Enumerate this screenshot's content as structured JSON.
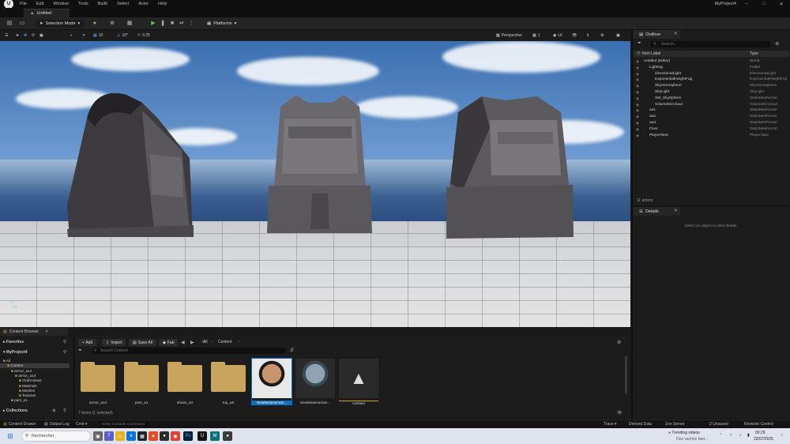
{
  "menubar": {
    "items": [
      "File",
      "Edit",
      "Window",
      "Tools",
      "Build",
      "Select",
      "Actor",
      "Help"
    ],
    "project_name": "MyProject4"
  },
  "tabs": {
    "level": "Untitled"
  },
  "toolbar": {
    "selection_mode": "Selection Mode",
    "platforms": "Platforms"
  },
  "viewport_bar": {
    "perspective": "Perspective",
    "lit": "Lit",
    "snap_translate": "10",
    "snap_rotate": "10°",
    "snap_scale": "0.25",
    "camera_speed": "1"
  },
  "outliner": {
    "tab": "Outliner",
    "search_placeholder": "Search...",
    "col_label": "Item Label",
    "col_type": "Type",
    "rows": [
      {
        "label": "Untitled (Editor)",
        "type": "World",
        "indent": 0
      },
      {
        "label": "Lighting",
        "type": "Folder",
        "indent": 1
      },
      {
        "label": "DirectionalLight",
        "type": "DirectionalLight",
        "indent": 2
      },
      {
        "label": "ExponentialHeightFog",
        "type": "ExponentialHeightFog",
        "indent": 2
      },
      {
        "label": "SkyAtmosphere",
        "type": "SkyAtmosphere",
        "indent": 2
      },
      {
        "label": "SkyLight",
        "type": "SkyLight",
        "indent": 2
      },
      {
        "label": "SM_SkySphere",
        "type": "StaticMeshActor",
        "indent": 2
      },
      {
        "label": "VolumetricCloud",
        "type": "VolumetricCloud",
        "indent": 2
      },
      {
        "label": "aa1",
        "type": "StaticMeshActor",
        "indent": 1
      },
      {
        "label": "aa2",
        "type": "StaticMeshActor",
        "indent": 1
      },
      {
        "label": "aa3",
        "type": "StaticMeshActor",
        "indent": 1
      },
      {
        "label": "Floor",
        "type": "StaticMeshActor",
        "indent": 1
      },
      {
        "label": "PlayerStart",
        "type": "PlayerStart",
        "indent": 1
      }
    ],
    "actor_count": "11 actors"
  },
  "details": {
    "tab": "Details",
    "empty_text": "Select an object to view details."
  },
  "content_browser": {
    "tab": "Content Browser",
    "favorites": "Favorites",
    "project": "MyProject4",
    "collections": "Collections",
    "add": "Add",
    "import": "Import",
    "save_all": "Save All",
    "fab": "Fab",
    "path": [
      "All",
      "Content"
    ],
    "search_placeholder": "Search Content",
    "tree": [
      {
        "label": "All",
        "indent": 0
      },
      {
        "label": "Content",
        "indent": 1,
        "selected": true
      },
      {
        "label": "armor_a14",
        "indent": 2
      },
      {
        "label": "armor_a14",
        "indent": 3
      },
      {
        "label": "ClothAssets",
        "indent": 4
      },
      {
        "label": "Materials",
        "indent": 4
      },
      {
        "label": "Meshes",
        "indent": 4
      },
      {
        "label": "Textures",
        "indent": 4
      },
      {
        "label": "pant_a1",
        "indent": 2
      }
    ],
    "assets": [
      {
        "name": "armor_a14",
        "kind": "folder"
      },
      {
        "name": "pant_a1",
        "kind": "folder"
      },
      {
        "name": "shoes_a3",
        "kind": "folder"
      },
      {
        "name": "top_a6",
        "kind": "folder"
      },
      {
        "name": "NewMetaHuman...",
        "kind": "metahuman-a",
        "selected": true
      },
      {
        "name": "NewMetaHuman...",
        "kind": "metahuman-b"
      },
      {
        "name": "Untitled",
        "kind": "level"
      }
    ],
    "item_count": "7 items (1 selected)"
  },
  "statusbar": {
    "content_drawer": "Content Drawer",
    "output_log": "Output Log",
    "cmd": "Cmd",
    "console_placeholder": "Enter Console Command",
    "trace": "Trace",
    "derived_data": "Derived Data",
    "zen_server": "Zen Server",
    "unsaved": "2 Unsaved",
    "revision_control": "Revision Control"
  },
  "taskbar": {
    "search_placeholder": "Rechercher",
    "news_title": "Trending videos",
    "news_sub": "Des vachon fast...",
    "time": "00:29",
    "date": "23/07/2025"
  }
}
